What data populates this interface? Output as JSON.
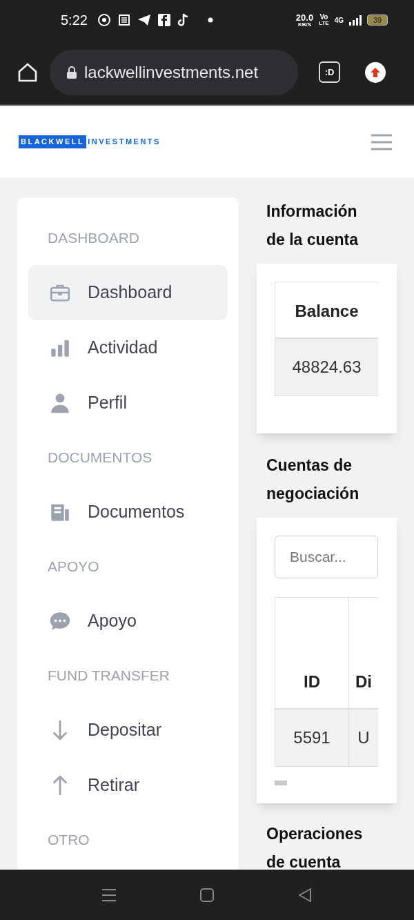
{
  "status_bar": {
    "time": "5:22",
    "speed": "20.0",
    "speed_unit": "KB/S",
    "volte_top": "Vo",
    "volte_bottom": "LTE",
    "network": "4G",
    "battery": "39"
  },
  "browser": {
    "url": "lackwellinvestments.net",
    "tab_badge": ":D"
  },
  "header": {
    "logo_primary": "BLACKWELL",
    "logo_secondary": "INVESTMENTS"
  },
  "sidebar": {
    "sections": [
      {
        "title": "DASHBOARD",
        "items": [
          {
            "label": "Dashboard",
            "selected": true
          },
          {
            "label": "Actividad",
            "selected": false
          },
          {
            "label": "Perfil",
            "selected": false
          }
        ]
      },
      {
        "title": "DOCUMENTOS",
        "items": [
          {
            "label": "Documentos",
            "selected": false
          }
        ]
      },
      {
        "title": "APOYO",
        "items": [
          {
            "label": "Apoyo",
            "selected": false
          }
        ]
      },
      {
        "title": "FUND TRANSFER",
        "items": [
          {
            "label": "Depositar",
            "selected": false
          },
          {
            "label": "Retirar",
            "selected": false
          }
        ]
      },
      {
        "title": "OTRO"
      }
    ]
  },
  "account_info": {
    "title": "Información de la cuenta",
    "table": {
      "columns": [
        "Balance"
      ],
      "rows": [
        [
          "48824.63"
        ]
      ]
    }
  },
  "trading_accounts": {
    "title": "Cuentas de negociación",
    "search": {
      "placeholder": "Buscar..."
    },
    "table": {
      "columns": [
        "ID",
        "Di"
      ],
      "rows": [
        [
          "5591",
          "U"
        ]
      ]
    }
  },
  "account_operations": {
    "title": "Operaciones de cuenta"
  }
}
